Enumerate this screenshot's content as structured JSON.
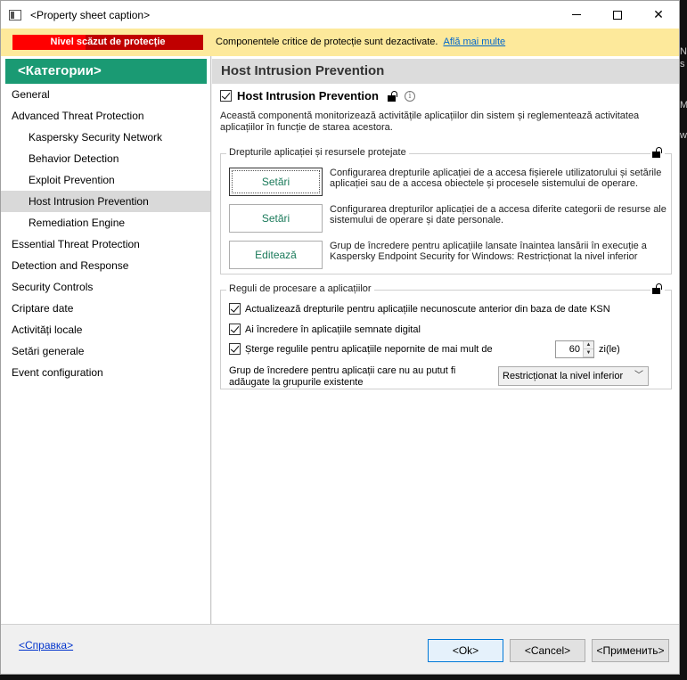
{
  "window": {
    "title": "<Property sheet caption>"
  },
  "notification": {
    "badge": "Nivel scăzut de protecție",
    "message": "Componentele critice de protecție sunt dezactivate.",
    "link": "Află mai multe"
  },
  "sidebar": {
    "header": "<Категории>",
    "items": [
      {
        "label": "General"
      },
      {
        "label": "Advanced Threat Protection"
      },
      {
        "label": "Kaspersky Security Network"
      },
      {
        "label": "Behavior Detection"
      },
      {
        "label": "Exploit Prevention"
      },
      {
        "label": "Host Intrusion Prevention"
      },
      {
        "label": "Remediation Engine"
      },
      {
        "label": "Essential Threat Protection"
      },
      {
        "label": "Detection and Response"
      },
      {
        "label": "Security Controls"
      },
      {
        "label": "Criptare date"
      },
      {
        "label": "Activități locale"
      },
      {
        "label": "Setări generale"
      },
      {
        "label": "Event configuration"
      }
    ]
  },
  "content": {
    "header": "Host Intrusion Prevention",
    "feature_title": "Host Intrusion Prevention",
    "feature_enabled": true,
    "description": "Această componentă monitorizează activitățile aplicațiilor din sistem și reglementează activitatea aplicațiilor în funcție de starea acestora.",
    "group1": {
      "title": "Drepturile aplicației și resursele protejate",
      "rows": [
        {
          "button": "Setări",
          "text": "Configurarea drepturile aplicației de a accesa fișierele utilizatorului și setările aplicației sau de a accesa obiectele și procesele sistemului de operare."
        },
        {
          "button": "Setări",
          "text": "Configurarea drepturilor aplicației de a accesa diferite categorii de resurse ale sistemului de operare și date personale."
        },
        {
          "button": "Editează",
          "text": "Grup de încredere pentru aplicațiile lansate înaintea lansării în execuție a Kaspersky Endpoint Security for Windows: Restricționat la nivel inferior"
        }
      ]
    },
    "group2": {
      "title": "Reguli de procesare a aplicațiilor",
      "opt1": "Actualizează drepturile pentru aplicațiile necunoscute anterior din baza de date KSN",
      "opt2": "Ai încredere în aplicațiile semnate digital",
      "opt3": "Șterge regulile pentru aplicațiile nepornite de mai mult de",
      "days_value": "60",
      "days_unit": "zi(le)",
      "group_label": "Grup de încredere pentru aplicații care nu au putut fi adăugate la grupurile existente",
      "group_value": "Restricționat la nivel inferior"
    }
  },
  "footer": {
    "help": "<Справка>",
    "ok": "<Ok>",
    "cancel": "<Cancel>",
    "apply": "<Применить>"
  },
  "edge_fragments": [
    "N",
    "s",
    "Ma",
    "wi"
  ]
}
